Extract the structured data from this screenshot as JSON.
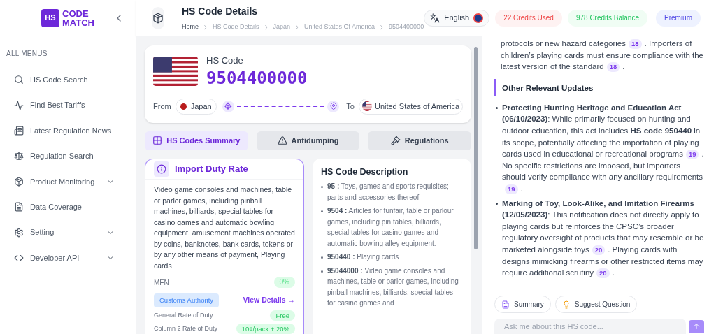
{
  "sidebar": {
    "logo_top": "HS",
    "logo_words": [
      "CODE",
      "MATCH"
    ],
    "section_label": "ALL MENUS",
    "items": [
      {
        "label": "HS Code Search",
        "has_submenu": false
      },
      {
        "label": "Find Best Tariffs",
        "has_submenu": false
      },
      {
        "label": "Latest Regulation News",
        "has_submenu": false
      },
      {
        "label": "Regulation Search",
        "has_submenu": false
      },
      {
        "label": "Product Monitoring",
        "has_submenu": true
      },
      {
        "label": "Data Coverage",
        "has_submenu": false
      },
      {
        "label": "Setting",
        "has_submenu": true
      },
      {
        "label": "Developer API",
        "has_submenu": true
      }
    ]
  },
  "header": {
    "title": "HS Code Details",
    "breadcrumbs": [
      "Home",
      "HS Code Details",
      "Japan",
      "United States Of America",
      "9504400000"
    ],
    "language": "English",
    "credits_used": "22 Credits Used",
    "credits_balance": "978 Credits Balance",
    "plan": "Premium"
  },
  "hs_card": {
    "label": "HS Code",
    "code": "9504400000",
    "from_label": "From",
    "from_country": "Japan",
    "to_label": "To",
    "to_country": "United States of America"
  },
  "tabs": [
    {
      "label": "HS Codes Summary",
      "selected": true
    },
    {
      "label": "Antidumping",
      "selected": false
    },
    {
      "label": "Regulations",
      "selected": false
    }
  ],
  "duty_card": {
    "title": "Import Duty Rate",
    "description": "Video game consoles and machines, table or parlor games, including pinball machines, billiards, special tables for casino games and automatic bowling equipment, amusement machines operated by coins, banknotes, bank cards, tokens or by any other means of payment, Playing cards",
    "mfn_label": "MFN",
    "mfn_value": "0%",
    "authority": "Customs Authority",
    "details_link": "View Details →",
    "rates": [
      {
        "label": "General Rate of Duty",
        "value": "Free"
      },
      {
        "label": "Column 2 Rate of Duty",
        "value": "10¢/pack + 20%"
      }
    ]
  },
  "description_card": {
    "title": "HS Code Description",
    "items": [
      {
        "code": "95 :",
        "text": "Toys, games and sports requisites; parts and accessories thereof"
      },
      {
        "code": "9504 :",
        "text": "Articles for funfair, table or parlour games, including pin tables, billiards, special tables for casino games and automatic bowling alley equipment."
      },
      {
        "code": "950440 :",
        "text": "Playing cards"
      },
      {
        "code": "95044000 :",
        "text": "Video game consoles and machines, table or parlor games, including pinball machines, billiards, special tables for casino games and"
      }
    ]
  },
  "assistant": {
    "blocks": [
      {
        "kind": "paragraph",
        "segments": [
          {
            "text": "protocols or new hazard categories"
          },
          {
            "cite": "18"
          },
          {
            "text": ". Importers of children’s playing cards must ensure compliance with the latest version of the standard"
          },
          {
            "cite": "18"
          },
          {
            "text": "."
          }
        ]
      },
      {
        "kind": "heading",
        "text": "Other Relevant Updates"
      },
      {
        "kind": "bullet",
        "segments": [
          {
            "text": "**Protecting Hunting Heritage and Education Act (06/10/2023)**: While primarily focused on hunting and outdoor education, this act includes **HS code 950440** in its scope, potentially affecting the importation of playing cards used in educational or recreational programs"
          },
          {
            "cite": "19"
          },
          {
            "text": ". No specific restrictions are imposed, but importers should verify compliance with any ancillary requirements"
          },
          {
            "cite": "19"
          },
          {
            "text": "."
          }
        ]
      },
      {
        "kind": "bullet",
        "segments": [
          {
            "text": "**Marking of Toy, Look-Alike, and Imitation Firearms (12/05/2023)**: This notification does not directly apply to playing cards but reinforces the CPSC’s broader regulatory oversight of products that may resemble or be marketed alongside toys"
          },
          {
            "cite": "20"
          },
          {
            "text": ". Playing cards with designs mimicking firearms or other restricted items may require additional scrutiny"
          },
          {
            "cite": "20"
          },
          {
            "text": "."
          }
        ]
      }
    ],
    "actions": [
      {
        "label": "Summary"
      },
      {
        "label": "Suggest Question"
      }
    ],
    "input_placeholder": "Ask me about this HS code..."
  }
}
